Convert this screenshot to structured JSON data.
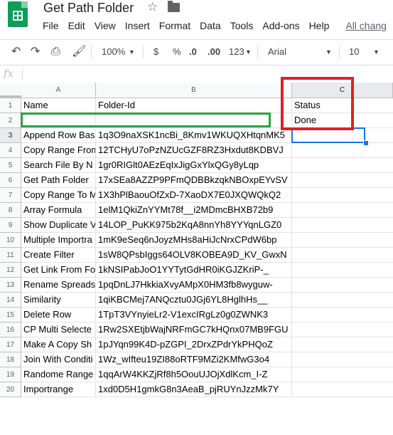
{
  "header": {
    "doc_title": "Get Path Folder",
    "menu": [
      "File",
      "Edit",
      "View",
      "Insert",
      "Format",
      "Data",
      "Tools",
      "Add-ons",
      "Help"
    ],
    "changes_link": "All chang"
  },
  "toolbar": {
    "zoom": "100%",
    "currency": "$",
    "percent": "%",
    "dec_decrease": ".0",
    "dec_increase": ".00",
    "more_formats": "123",
    "font": "Arial",
    "font_size": "10"
  },
  "formula_bar": {
    "fx_label": "fx",
    "value": ""
  },
  "sheet": {
    "columns": [
      "A",
      "B",
      "C"
    ],
    "selected_column": "C",
    "selected_row": "3",
    "row_numbers": [
      "1",
      "2",
      "3",
      "4",
      "5",
      "6",
      "7",
      "8",
      "9",
      "10",
      "11",
      "12",
      "13",
      "14",
      "15",
      "16",
      "17",
      "18",
      "19",
      "20"
    ],
    "rows": [
      {
        "a": "Name",
        "b": "Folder-Id",
        "c": "Status"
      },
      {
        "a": "",
        "b": "",
        "c": "Done"
      },
      {
        "a": "Append Row Based",
        "b": "1q3O9naXSK1ncBi_8Kmv1WKUQXHtqnMK5",
        "c": ""
      },
      {
        "a": "Copy Range From",
        "b": "12TCHyU7oPzNZUcGZF8RZ3Hxdut8KDBVJ",
        "c": ""
      },
      {
        "a": "Search File By N",
        "b": "1gr0RIGlt0AEzEqIxJigGxYlxQGy8yLqp",
        "c": ""
      },
      {
        "a": "Get Path Folder",
        "b": "17xSEa8AZZP9PFmQDBBkzqkNBOxpEYvSV",
        "c": ""
      },
      {
        "a": "Copy Range To M",
        "b": "1X3hPlBaouOfZxD-7XaoDX7E0JXQWQkQ2",
        "c": ""
      },
      {
        "a": "Array Formula",
        "b": "1elM1QkiZnYYMt78f__i2MDmcBHXB72b9",
        "c": ""
      },
      {
        "a": "Show Duplicate V",
        "b": "14LOP_PuKK975b2KqA8nnYh8YYYqnLGZ0",
        "c": ""
      },
      {
        "a": "Multiple Importra",
        "b": "1mK9eSeq6nJoyzMHs8aHiJcNrxCPdW6bp",
        "c": ""
      },
      {
        "a": "Create Filter",
        "b": "1sW8QPsbIggs64OLV8KOBEA9D_KV_GwxN",
        "c": ""
      },
      {
        "a": "Get Link From Fo",
        "b": "1kNSIPabJoO1YYTytGdHR0iKGJZKriP-_",
        "c": ""
      },
      {
        "a": "Rename Spreads",
        "b": "1pqDnLJ7HkkiaXvyAMpX0HM3fb8wyguw-",
        "c": ""
      },
      {
        "a": "Similarity",
        "b": "1qiKBCMej7ANQcztu0JGj6YL8HglhHs__",
        "c": ""
      },
      {
        "a": "Delete Row",
        "b": "1TpT3VYnyieLr2-V1excIRgLz0g0ZWNK3",
        "c": ""
      },
      {
        "a": "CP Multi Selecte",
        "b": "1Rw2SXEtjbWajNRFmGC7kHQnx07MB9FGU",
        "c": ""
      },
      {
        "a": "Make A Copy Sh",
        "b": "1pJYqn99K4D-pZGPI_2DrxZPdrYkPHQoZ",
        "c": ""
      },
      {
        "a": "Join With Conditi",
        "b": "1Wz_wIfteu19ZI88oRTF9MZi2KMfwG3o4",
        "c": ""
      },
      {
        "a": "Randome Range",
        "b": "1qqArW4KKZjRf8h5OouUJOjXdlKcm_I-Z",
        "c": ""
      },
      {
        "a": "Importrange",
        "b": "1xd0D5H1gmkG8n3AeaB_pjRUYnJzzMk7Y",
        "c": ""
      }
    ]
  },
  "colors": {
    "green_highlight": "#22a83a",
    "red_highlight": "#e0202b",
    "selection": "#1a73e8"
  }
}
